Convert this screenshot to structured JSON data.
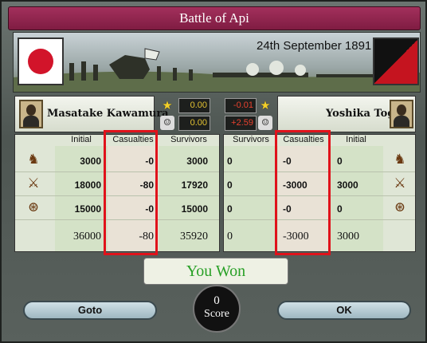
{
  "window": {
    "title": "Battle of Api"
  },
  "banner": {
    "date": "24th September 1891"
  },
  "left": {
    "commander": "Masatake Kawamura",
    "stat_top": "0.00",
    "stat_bottom": "0.00",
    "headers": {
      "initial": "Initial",
      "casualties": "Casualties",
      "survivors": "Survivors"
    },
    "rows": [
      {
        "unit": "cavalry",
        "initial": "3000",
        "casualties": "-0",
        "survivors": "3000"
      },
      {
        "unit": "infantry",
        "initial": "18000",
        "casualties": "-80",
        "survivors": "17920"
      },
      {
        "unit": "artillery",
        "initial": "15000",
        "casualties": "-0",
        "survivors": "15000"
      }
    ],
    "total": {
      "initial": "36000",
      "casualties": "-80",
      "survivors": "35920"
    }
  },
  "right": {
    "commander": "Yoshika Togo",
    "stat_top": "-0.01",
    "stat_bottom": "+2.59",
    "headers": {
      "survivors": "Survivors",
      "casualties": "Casualties",
      "initial": "Initial"
    },
    "rows": [
      {
        "unit": "cavalry",
        "survivors": "0",
        "casualties": "-0",
        "initial": "0"
      },
      {
        "unit": "infantry",
        "survivors": "0",
        "casualties": "-3000",
        "initial": "3000"
      },
      {
        "unit": "artillery",
        "survivors": "0",
        "casualties": "-0",
        "initial": "0"
      }
    ],
    "total": {
      "survivors": "0",
      "casualties": "-3000",
      "initial": "3000"
    }
  },
  "result": {
    "text": "You Won"
  },
  "score": {
    "value": "0",
    "label": "Score"
  },
  "buttons": {
    "goto": "Goto",
    "ok": "OK"
  },
  "colors": {
    "title_bar": "#8f2450",
    "win_text": "#28a026",
    "highlight": "#e0121b",
    "stat_yellow": "#e3c232",
    "stat_red": "#e8412e"
  },
  "icons": {
    "star": "star-icon",
    "leader": "leader-icon",
    "cavalry": "cavalry-icon",
    "infantry": "infantry-icon",
    "artillery": "artillery-icon"
  }
}
